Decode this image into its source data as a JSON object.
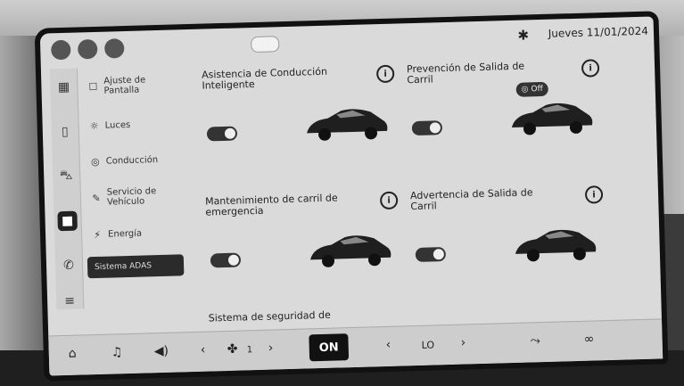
{
  "status": {
    "bluetooth_icon": "bluetooth-icon",
    "date": "Jueves 11/01/2024"
  },
  "sidebar": {
    "items": [
      {
        "label": "Ajuste de\nPantalla",
        "icon": "display-icon"
      },
      {
        "label": "Luces",
        "icon": "lights-icon"
      },
      {
        "label": "Conducción",
        "icon": "steering-icon"
      },
      {
        "label": "Servicio de\nVehículo",
        "icon": "wrench-icon"
      },
      {
        "label": "Energía",
        "icon": "battery-icon"
      }
    ],
    "selected_label": "Sistema ADAS"
  },
  "features": [
    {
      "title": "Asistencia de Conducción Inteligente",
      "enabled": true
    },
    {
      "title": "Prevención de Salida de Carril",
      "enabled": true,
      "badge": "Off"
    },
    {
      "title": "Mantenimiento de carril de emergencia",
      "enabled": true
    },
    {
      "title": "Advertencia de Salida de Carril",
      "enabled": true
    }
  ],
  "bottom_partial_title": "Sistema de seguridad de",
  "dock": {
    "home_icon": "home-icon",
    "music_icon": "music-icon",
    "volume_icon": "volume-icon",
    "fan_level": "1",
    "on_label": "ON",
    "temp_label": "LO"
  }
}
